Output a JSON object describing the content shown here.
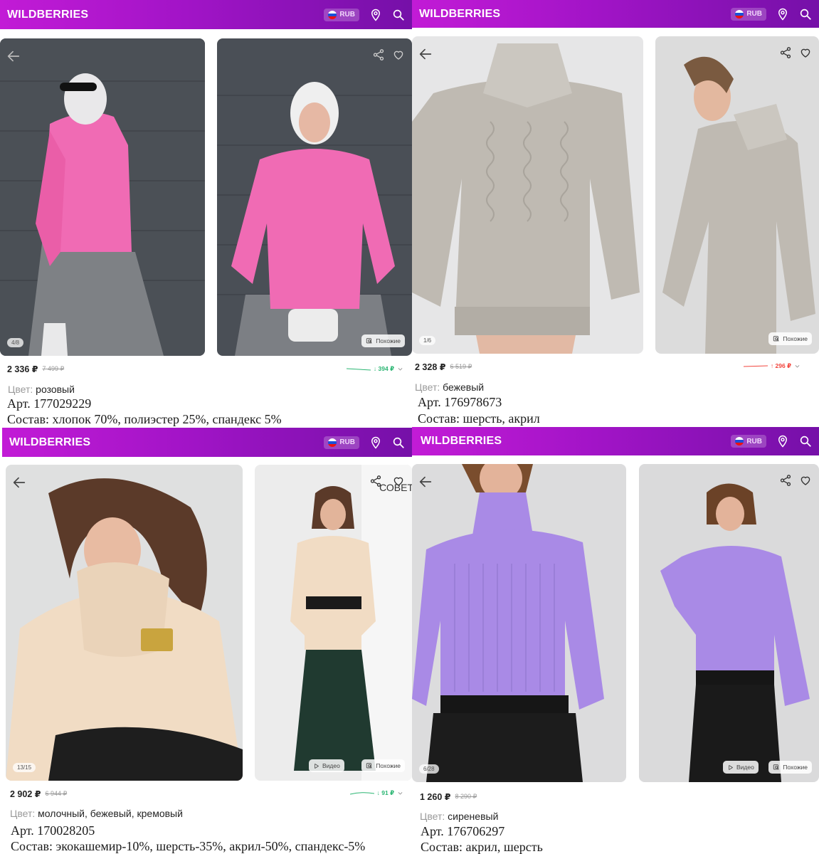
{
  "header": {
    "logo": "WILDBERRIES",
    "currency": "RUB"
  },
  "panels": [
    {
      "counter": "4/8",
      "similar_label": "Похожие",
      "price": "2 336 ₽",
      "old_price": "7 499 ₽",
      "price_change": "↓ 394 ₽",
      "trend_direction": "down",
      "trend_color": "#2bb673",
      "color_label": "Цвет:",
      "color_value": "розовый",
      "article": "Арт. 177029229",
      "composition": "Состав: хлопок 70%, полиэстер 25%, спандекс 5%"
    },
    {
      "counter": "1/6",
      "similar_label": "Похожие",
      "price": "2 328 ₽",
      "old_price": "6 519 ₽",
      "price_change": "↑ 296 ₽",
      "trend_direction": "up",
      "trend_color": "#f2453d",
      "color_label": "Цвет:",
      "color_value": "бежевый",
      "article": "Арт. 176978673",
      "composition": "Состав: шерсть, акрил"
    },
    {
      "counter": "13/15",
      "video_label": "Видео",
      "similar_label": "Похожие",
      "overlay_word": "СОВЕТ",
      "price": "2 902 ₽",
      "old_price": "6 944 ₽",
      "price_change": "↓ 91 ₽",
      "trend_direction": "down",
      "trend_color": "#2bb673",
      "color_label": "Цвет:",
      "color_value": "молочный, бежевый, кремовый",
      "article": "Арт. 170028205",
      "composition": "Состав: экокашемир-10%, шерсть-35%, акрил-50%, спандекс-5%"
    },
    {
      "counter": "6/28",
      "video_label": "Видео",
      "similar_label": "Похожие",
      "price": "1 260 ₽",
      "old_price": "8 290 ₽",
      "color_label": "Цвет:",
      "color_value": "сиреневый",
      "article": "Арт. 176706297",
      "composition": "Состав: акрил, шерсть"
    }
  ],
  "colors": {
    "header_gradient_start": "#c21bd6",
    "header_gradient_end": "#7510a8",
    "pink_sweater": "#f06bb4",
    "grey_sweater": "#bfbab2",
    "cream_sweater": "#f1dcc4",
    "lilac_sweater": "#a98ae6"
  },
  "icons": [
    "location-icon",
    "search-icon",
    "back-arrow-icon",
    "share-icon",
    "heart-icon",
    "similar-icon",
    "play-icon",
    "chevron-down-icon"
  ]
}
